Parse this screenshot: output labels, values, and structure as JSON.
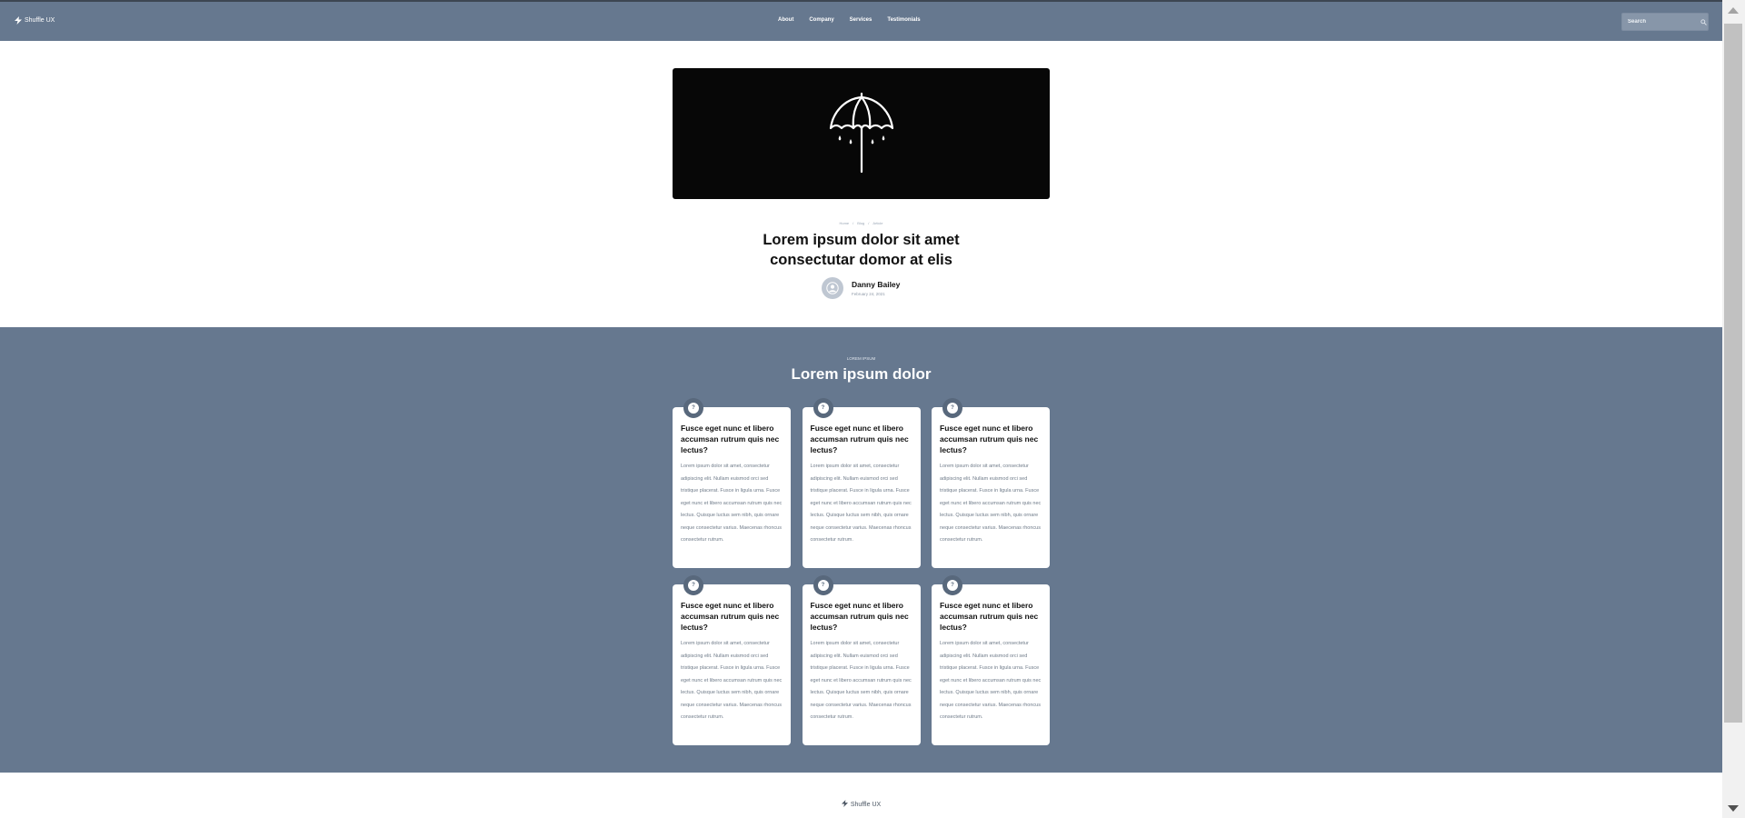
{
  "brand": {
    "name": "Shuffle UX"
  },
  "nav": {
    "items": [
      "About",
      "Company",
      "Services",
      "Testimonials"
    ]
  },
  "search": {
    "placeholder": "Search"
  },
  "article": {
    "breadcrumb": [
      "Home",
      "/",
      "Blog",
      "/",
      "Article"
    ],
    "title_line1": "Lorem ipsum dolor sit amet",
    "title_line2": "consectutar domor at elis",
    "author_name": "Danny Bailey",
    "author_date": "February 24, 2021"
  },
  "features": {
    "kicker": "LOREM IPSUM",
    "title": "Lorem ipsum dolor",
    "cards": [
      {
        "badge": "?",
        "title": "Fusce eget nunc et libero accumsan rutrum quis nec lectus?",
        "text": "Lorem ipsum dolor sit amet, consectetur adipiscing elit. Nullam euismod orci sed tristique placerat. Fusce in ligula urna. Fusce eget nunc et libero accumsan rutrum quis nec lectus. Quisque luctus sem nibh, quis ornare neque consectetur varius. Maecenas rhoncus consectetur rutrum."
      },
      {
        "badge": "?",
        "title": "Fusce eget nunc et libero accumsan rutrum quis nec lectus?",
        "text": "Lorem ipsum dolor sit amet, consectetur adipiscing elit. Nullam euismod orci sed tristique placerat. Fusce in ligula urna. Fusce eget nunc et libero accumsan rutrum quis nec lectus. Quisque luctus sem nibh, quis ornare neque consectetur varius. Maecenas rhoncus consectetur rutrum."
      },
      {
        "badge": "?",
        "title": "Fusce eget nunc et libero accumsan rutrum quis nec lectus?",
        "text": "Lorem ipsum dolor sit amet, consectetur adipiscing elit. Nullam euismod orci sed tristique placerat. Fusce in ligula urna. Fusce eget nunc et libero accumsan rutrum quis nec lectus. Quisque luctus sem nibh, quis ornare neque consectetur varius. Maecenas rhoncus consectetur rutrum."
      },
      {
        "badge": "?",
        "title": "Fusce eget nunc et libero accumsan rutrum quis nec lectus?",
        "text": "Lorem ipsum dolor sit amet, consectetur adipiscing elit. Nullam euismod orci sed tristique placerat. Fusce in ligula urna. Fusce eget nunc et libero accumsan rutrum quis nec lectus. Quisque luctus sem nibh, quis ornare neque consectetur varius. Maecenas rhoncus consectetur rutrum."
      },
      {
        "badge": "?",
        "title": "Fusce eget nunc et libero accumsan rutrum quis nec lectus?",
        "text": "Lorem ipsum dolor sit amet, consectetur adipiscing elit. Nullam euismod orci sed tristique placerat. Fusce in ligula urna. Fusce eget nunc et libero accumsan rutrum quis nec lectus. Quisque luctus sem nibh, quis ornare neque consectetur varius. Maecenas rhoncus consectetur rutrum."
      },
      {
        "badge": "?",
        "title": "Fusce eget nunc et libero accumsan rutrum quis nec lectus?",
        "text": "Lorem ipsum dolor sit amet, consectetur adipiscing elit. Nullam euismod orci sed tristique placerat. Fusce in ligula urna. Fusce eget nunc et libero accumsan rutrum quis nec lectus. Quisque luctus sem nibh, quis ornare neque consectetur varius. Maecenas rhoncus consectetur rutrum."
      }
    ]
  },
  "footer": {
    "brand": "Shuffle UX"
  },
  "colors": {
    "header_bg": "#66788f",
    "section_bg": "#66788f",
    "badge_bg": "#58687c",
    "hero_bg": "#070707",
    "text_dark": "#111111",
    "text_muted": "#6f7b89"
  },
  "icons": {
    "brand": "lightning-bolt-icon",
    "search": "search-icon",
    "hero": "umbrella-icon",
    "avatar": "user-icon",
    "card_badge": "question-icon"
  }
}
